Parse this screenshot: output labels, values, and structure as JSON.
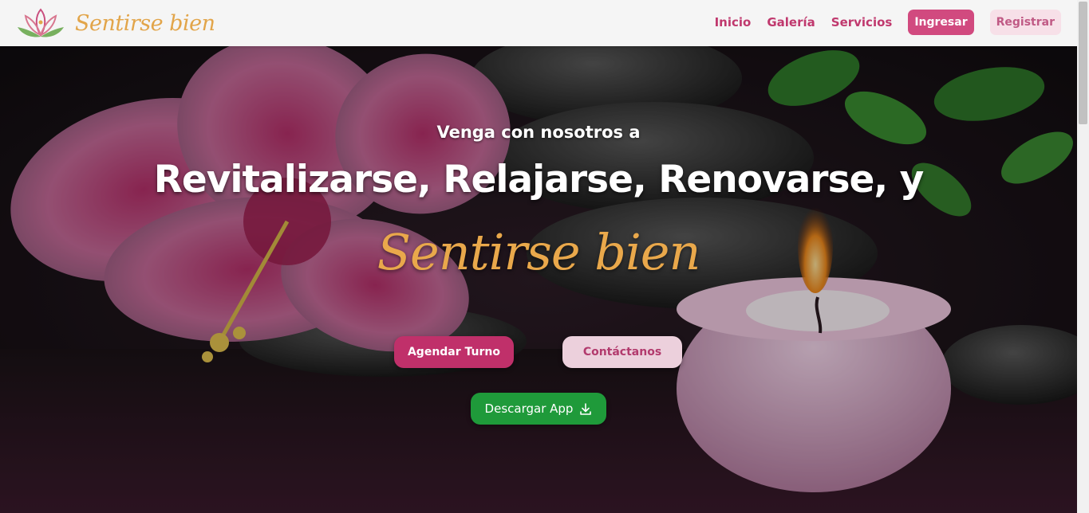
{
  "navbar": {
    "brand_name": "Sentirse bien",
    "logo_icon": "lotus-logo-icon",
    "links": [
      "Inicio",
      "Galería",
      "Servicios"
    ],
    "login_label": "Ingresar",
    "register_label": "Registrar"
  },
  "hero": {
    "subtitle": "Venga con nosotros a",
    "title": "Revitalizarse, Relajarse, Renovarse, y",
    "brand": "Sentirse bien",
    "buttons": {
      "book": "Agendar Turno",
      "contact": "Contáctanos",
      "app": "Descargar App"
    },
    "app_icon": "download-icon",
    "background": "spa-stones-hibiscus-candle-photo"
  },
  "colors": {
    "brand_gold": "#e2a54a",
    "accent_pink": "#c0396e",
    "login_bg": "#d14a7f",
    "register_bg": "#f7e0e8",
    "book_bg": "#c0306a",
    "contact_bg": "#ecd0dc",
    "app_bg": "#1f9a3a"
  }
}
